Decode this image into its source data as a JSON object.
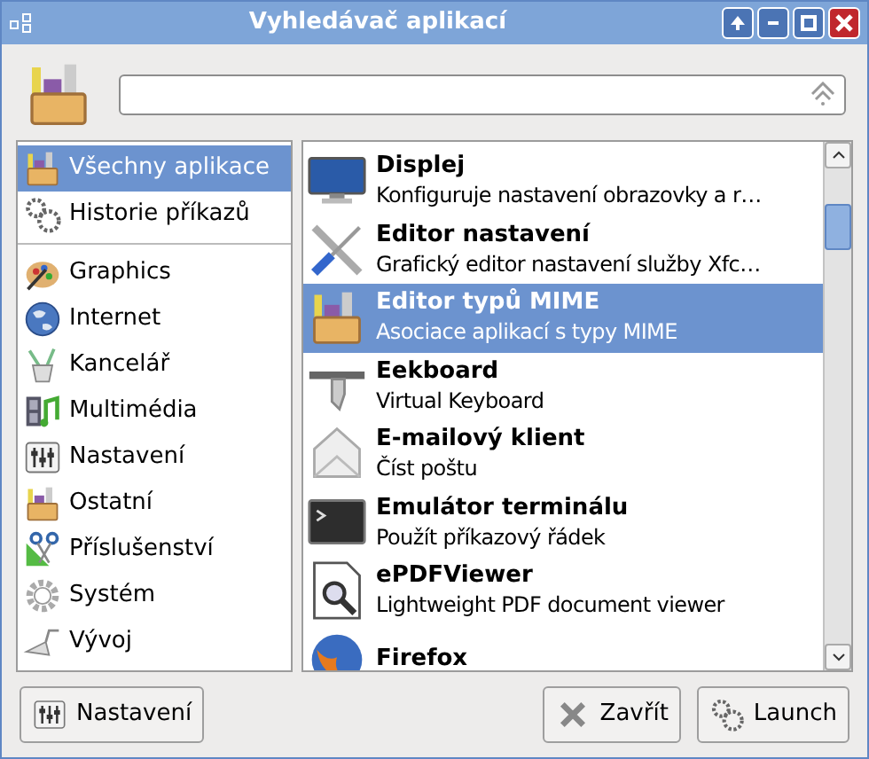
{
  "window": {
    "title": "Vyhledávač aplikací"
  },
  "sidebar": {
    "sections": [
      {
        "items": [
          {
            "label": "Všechny aplikace",
            "selected": true
          },
          {
            "label": "Historie příkazů",
            "selected": false
          }
        ]
      },
      {
        "items": [
          {
            "label": "Graphics",
            "selected": false
          },
          {
            "label": "Internet",
            "selected": false
          },
          {
            "label": "Kancelář",
            "selected": false
          },
          {
            "label": "Multimédia",
            "selected": false
          },
          {
            "label": "Nastavení",
            "selected": false
          },
          {
            "label": "Ostatní",
            "selected": false
          },
          {
            "label": "Příslušenství",
            "selected": false
          },
          {
            "label": "Systém",
            "selected": false
          },
          {
            "label": "Vývoj",
            "selected": false
          }
        ]
      }
    ]
  },
  "apps": [
    {
      "name": "Displej",
      "description": "Konfiguruje nastavení obrazovky a r…",
      "selected": false
    },
    {
      "name": "Editor nastavení",
      "description": "Grafický editor nastavení služby Xfc…",
      "selected": false
    },
    {
      "name": "Editor typů MIME",
      "description": "Asociace aplikací s typy MIME",
      "selected": true
    },
    {
      "name": "Eekboard",
      "description": "Virtual Keyboard",
      "selected": false
    },
    {
      "name": "E-mailový klient",
      "description": "Číst poštu",
      "selected": false
    },
    {
      "name": "Emulátor terminálu",
      "description": "Použít příkazový řádek",
      "selected": false
    },
    {
      "name": "ePDFViewer",
      "description": "Lightweight PDF document viewer",
      "selected": false
    },
    {
      "name": "Firefox",
      "selected": false
    }
  ],
  "buttons": [
    {
      "label": "Nastavení",
      "kind": "left"
    },
    {
      "label": "Zavřít",
      "kind": "right"
    },
    {
      "label": "Launch",
      "kind": "right"
    }
  ]
}
